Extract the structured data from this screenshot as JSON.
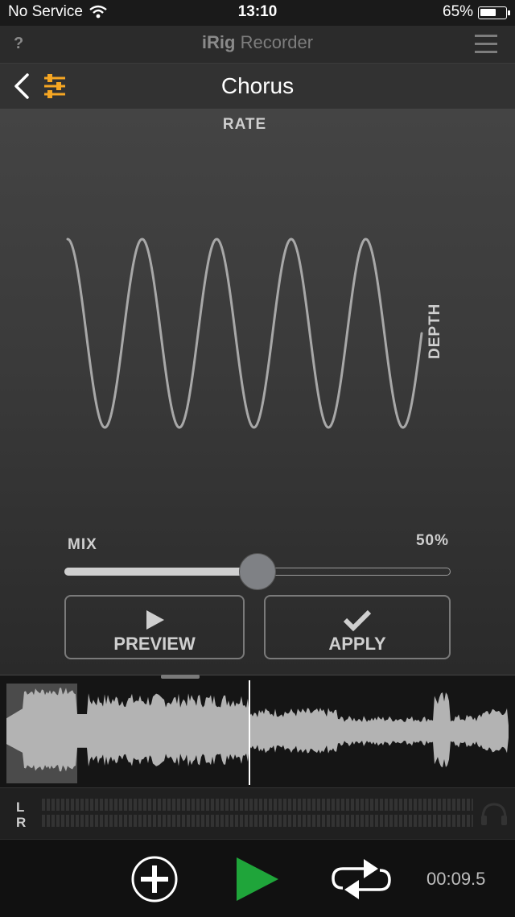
{
  "status_bar": {
    "carrier": "No Service",
    "time": "13:10",
    "battery": "65%",
    "battery_level": 0.65,
    "wifi_icon": "wifi-icon"
  },
  "app_header": {
    "help_label": "?",
    "brand_bold": "iRig",
    "brand_rest": " Recorder",
    "menu_icon": "hamburger-menu-icon"
  },
  "effect_header": {
    "title": "Chorus",
    "back_icon": "chevron-left-icon",
    "settings_icon": "sliders-icon"
  },
  "effect": {
    "rate_label": "RATE",
    "depth_label": "DEPTH",
    "mix_label": "MIX",
    "mix_value": "50%",
    "mix_fraction": 0.5
  },
  "buttons": {
    "preview_label": "PREVIEW",
    "apply_label": "APPLY"
  },
  "meters": {
    "left_label": "L",
    "right_label": "R",
    "headphones_icon": "headphones-icon"
  },
  "transport": {
    "time": "00:09.5",
    "add_icon": "plus-circle-icon",
    "play_icon": "play-icon",
    "loop_icon": "loop-icon"
  },
  "colors": {
    "accent_orange": "#f5a623",
    "play_green": "#1fa53a"
  }
}
